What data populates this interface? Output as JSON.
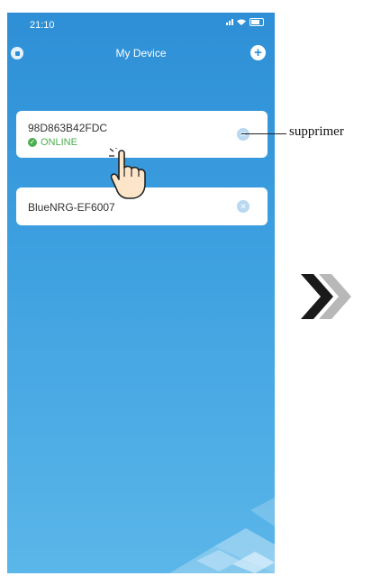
{
  "status_bar": {
    "time": "21:10"
  },
  "header": {
    "title": "My Device",
    "menu_icon": "menu-icon",
    "add_icon": "plus-icon"
  },
  "sections": [
    {
      "label": "",
      "devices": [
        {
          "name": "98D863B42FDC",
          "status": "ONLINE",
          "status_color": "#4caf50"
        }
      ]
    },
    {
      "label": "",
      "devices": [
        {
          "name": "BlueNRG-EF6007"
        }
      ]
    }
  ],
  "callout": {
    "label": "supprimer"
  },
  "colors": {
    "accent": "#2e8fd6",
    "online": "#4caf50",
    "card": "#ffffff"
  }
}
